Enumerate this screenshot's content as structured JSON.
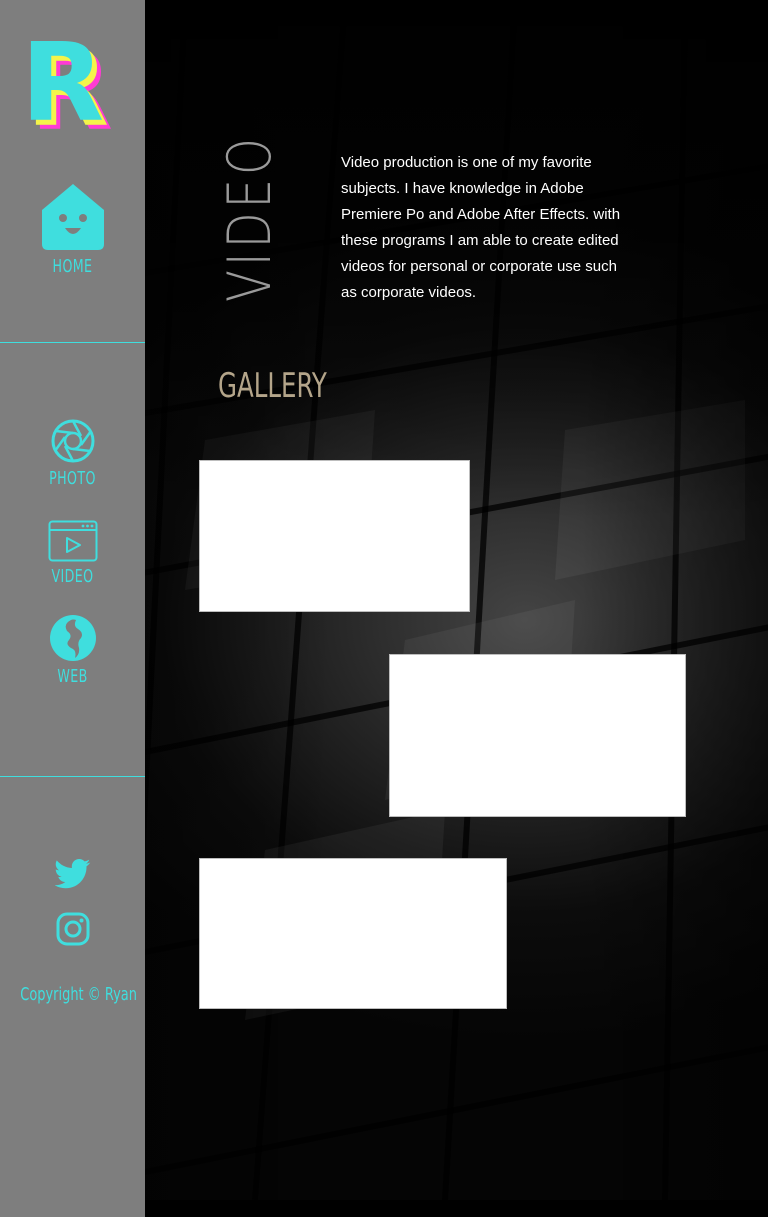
{
  "sidebar": {
    "logo_letter": "R",
    "nav": [
      {
        "label": "HOME",
        "icon": "home-icon"
      },
      {
        "label": "PHOTO",
        "icon": "camera-aperture-icon"
      },
      {
        "label": "VIDEO",
        "icon": "video-player-icon"
      },
      {
        "label": "WEB",
        "icon": "globe-icon"
      }
    ],
    "social": [
      {
        "icon": "twitter-icon"
      },
      {
        "icon": "instagram-icon"
      }
    ],
    "copyright": "Copyright © Ryan"
  },
  "main": {
    "title": "VIDEO",
    "description": "Video production is one of my favorite subjects. I have knowledge in Adobe Premiere Po and Adobe After Effects. with these programs I am able to create edited videos for personal or corporate use such as corporate videos.",
    "gallery_heading": "GALLERY",
    "videos": [
      {
        "name": "video-1"
      },
      {
        "name": "video-2"
      },
      {
        "name": "video-3"
      }
    ]
  },
  "colors": {
    "accent": "#3fdede",
    "sidebar_bg": "#7e7e7e",
    "gallery_heading": "#b4a58a",
    "logo_main": "#3fdede",
    "logo_pink": "#ff3bd4",
    "logo_yellow": "#f4f44a"
  }
}
